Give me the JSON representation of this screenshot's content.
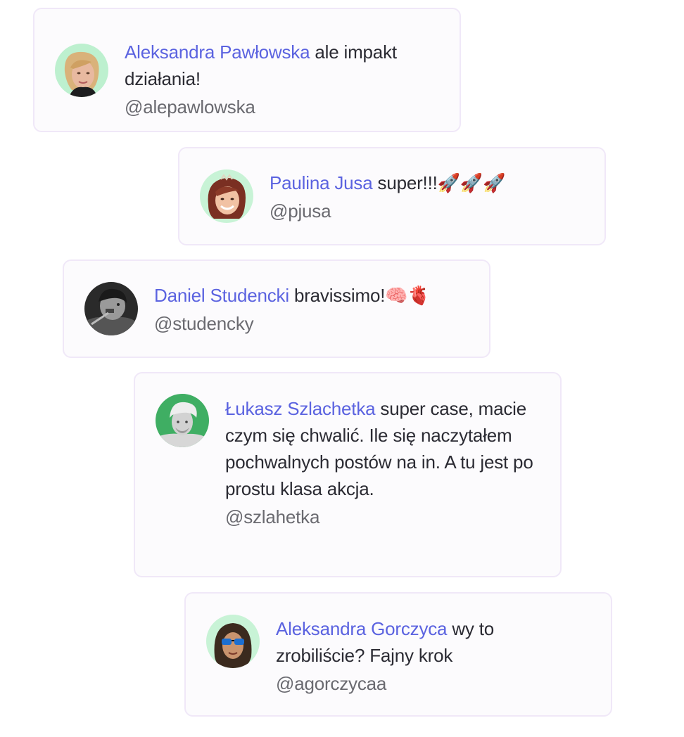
{
  "comments": [
    {
      "name": "Aleksandra Pawłowska",
      "message": "ale impakt działania!",
      "handle": "@alepawlowska",
      "avatar_bg": "#bdf0cf"
    },
    {
      "name": "Paulina Jusa",
      "message": "super!!!🚀🚀🚀",
      "handle": "@pjusa",
      "avatar_bg": "#c8f3d6"
    },
    {
      "name": "Daniel Studencki",
      "message": "bravissimo!🧠🫀",
      "handle": "@studencky",
      "avatar_bg": "#2a2a2a"
    },
    {
      "name": "Łukasz Szlachetka",
      "message": "super case, macie czym się chwalić. Ile się naczytałem pochwalnych postów na in. A tu jest po prostu klasa akcja.",
      "handle": "@szlahetka",
      "avatar_bg": "#3fae63"
    },
    {
      "name": "Aleksandra Gorczyca",
      "message": "wy to zrobiliście? Fajny krok",
      "handle": "@agorczycaa",
      "avatar_bg": "#c8f3d6"
    }
  ],
  "colors": {
    "name": "#5b63e0",
    "text": "#2b2b33",
    "handle": "#6a6a70",
    "card_border": "#f0e8f8"
  }
}
